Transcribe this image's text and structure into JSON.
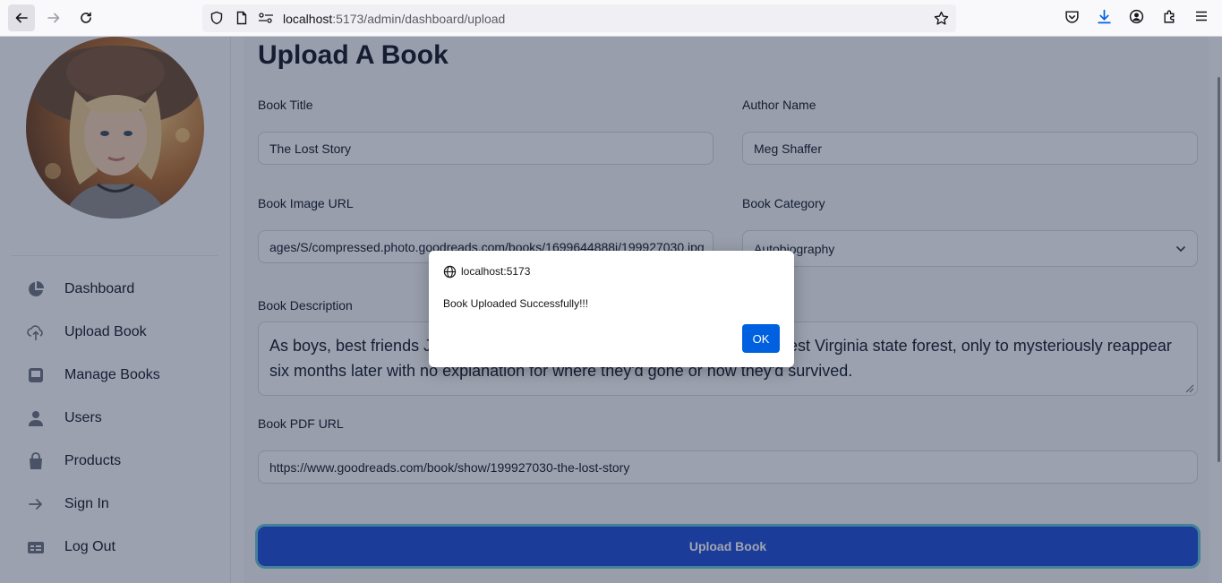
{
  "browser": {
    "url_host": "localhost",
    "url_path": ":5173/admin/dashboard/upload",
    "icons": [
      "back-icon",
      "forward-icon",
      "reload-icon",
      "shield-icon",
      "page-icon",
      "permissions-icon",
      "bookmark-star-icon",
      "pocket-icon",
      "download-icon",
      "account-icon",
      "extensions-icon",
      "menu-icon"
    ]
  },
  "sidebar": {
    "items": [
      {
        "label": "Dashboard",
        "icon": "pie-chart-icon"
      },
      {
        "label": "Upload Book",
        "icon": "cloud-upload-icon"
      },
      {
        "label": "Manage Books",
        "icon": "inbox-icon"
      },
      {
        "label": "Users",
        "icon": "user-icon"
      },
      {
        "label": "Products",
        "icon": "shopping-bag-icon"
      },
      {
        "label": "Sign In",
        "icon": "arrow-right-icon"
      },
      {
        "label": "Log Out",
        "icon": "table-icon"
      }
    ]
  },
  "form": {
    "title": "Upload A Book",
    "book_title_label": "Book Title",
    "book_title_value": "The Lost Story",
    "author_label": "Author Name",
    "author_value": "Meg Shaffer",
    "image_url_label": "Book Image URL",
    "image_url_value": "ages/S/compressed.photo.goodreads.com/books/1699644888i/199927030.jpg",
    "category_label": "Book Category",
    "category_value": "Autobiography",
    "description_label": "Book Description",
    "description_value": "As boys, best friends Jeremy Cox and Rafe Howell disappeared in the West Virginia state forest, only to mysteriously reappear six months later with no explanation for where they'd gone or how they'd survived.",
    "pdf_url_label": "Book PDF URL",
    "pdf_url_value": "https://www.goodreads.com/book/show/199927030-the-lost-story",
    "submit_label": "Upload Book"
  },
  "dialog": {
    "origin": "localhost:5173",
    "message": "Book Uploaded Successfully!!!",
    "ok_label": "OK"
  },
  "colors": {
    "primary": "#1d4ed8",
    "dialog_button": "#0061e0"
  }
}
